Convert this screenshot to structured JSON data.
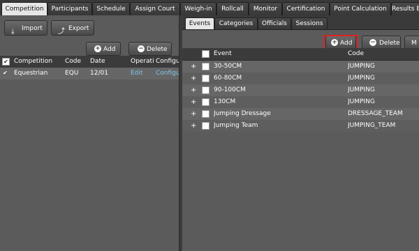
{
  "top_tabs": [
    "Competition",
    "Participants",
    "Schedule",
    "Assign Court",
    "Weigh-in",
    "Rollcall",
    "Monitor",
    "Certification",
    "Point Calculation",
    "Results B"
  ],
  "left": {
    "toolbar": {
      "import": "Import",
      "export": "Export"
    },
    "grid_toolbar": {
      "add": "Add",
      "delete": "Delete"
    },
    "columns": [
      "Competition",
      "Code",
      "Date",
      "Operatic",
      "Configu"
    ],
    "rows": [
      {
        "competition": "Equestrian",
        "code": "EQU",
        "date": "12/01",
        "op": "Edit",
        "config": "Configu"
      }
    ]
  },
  "right": {
    "sub_tabs": [
      "Events",
      "Categories",
      "Officials",
      "Sessions"
    ],
    "toolbar": {
      "add": "Add",
      "delete": "Delete",
      "more": "M"
    },
    "columns": [
      "Event",
      "Code"
    ],
    "rows": [
      {
        "event": "30-50CM",
        "code": "JUMPING"
      },
      {
        "event": "60-80CM",
        "code": "JUMPING"
      },
      {
        "event": "90-100CM",
        "code": "JUMPING"
      },
      {
        "event": "130CM",
        "code": "JUMPING"
      },
      {
        "event": "Jumping Dressage",
        "code": "DRESSAGE_TEAM"
      },
      {
        "event": "Jumping Team",
        "code": "JUMPING_TEAM"
      }
    ]
  }
}
